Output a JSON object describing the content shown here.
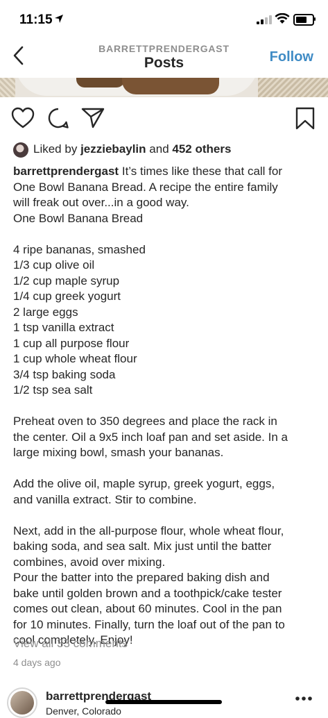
{
  "status_bar": {
    "time": "11:15"
  },
  "nav": {
    "account": "BARRETTPRENDERGAST",
    "title": "Posts",
    "follow_label": "Follow"
  },
  "likes": {
    "prefix": "Liked by",
    "user": "jezziebaylin",
    "and": "and",
    "count_text": "452 others"
  },
  "caption": {
    "username": "barrettprendergast",
    "lines": [
      "It’s times like these that call for",
      "One Bowl Banana Bread. A recipe the entire family",
      "will freak out over...in a good way.",
      "One Bowl Banana Bread",
      "",
      "4 ripe bananas, smashed",
      "1/3 cup olive oil",
      "1/2 cup maple syrup",
      "1/4 cup greek yogurt",
      "2 large eggs",
      "1 tsp vanilla extract",
      "1 cup all purpose flour",
      "1 cup whole wheat flour",
      "3/4 tsp baking soda",
      "1/2 tsp sea salt",
      "",
      "Preheat oven to 350 degrees and place the rack in",
      "the center. Oil a 9x5 inch loaf pan and set aside. In a",
      "large mixing bowl, smash your bananas.",
      "",
      "Add the olive oil, maple syrup, greek yogurt, eggs,",
      "and vanilla extract. Stir to combine.",
      "",
      "Next, add in the all-purpose flour, whole wheat flour,",
      "baking soda, and sea salt. Mix just until the batter",
      "combines, avoid over mixing.",
      "Pour the batter into the prepared baking dish and",
      "bake until golden brown and a toothpick/cake tester",
      "comes out clean, about 60 minutes. Cool in the pan",
      "for 10 minutes. Finally, turn the loaf out of the pan to",
      "cool completely. Enjoy!"
    ]
  },
  "comments_link": "View all 33 comments",
  "time_ago": "4 days ago",
  "next_post": {
    "username": "barrettprendergast",
    "location": "Denver, Colorado"
  },
  "icons": [
    "back-chevron-icon",
    "heart-icon",
    "comment-icon",
    "share-icon",
    "bookmark-icon",
    "more-icon"
  ],
  "colors": {
    "follow": "#3f8bc5",
    "text": "#262626",
    "muted": "#8e8e8e"
  }
}
